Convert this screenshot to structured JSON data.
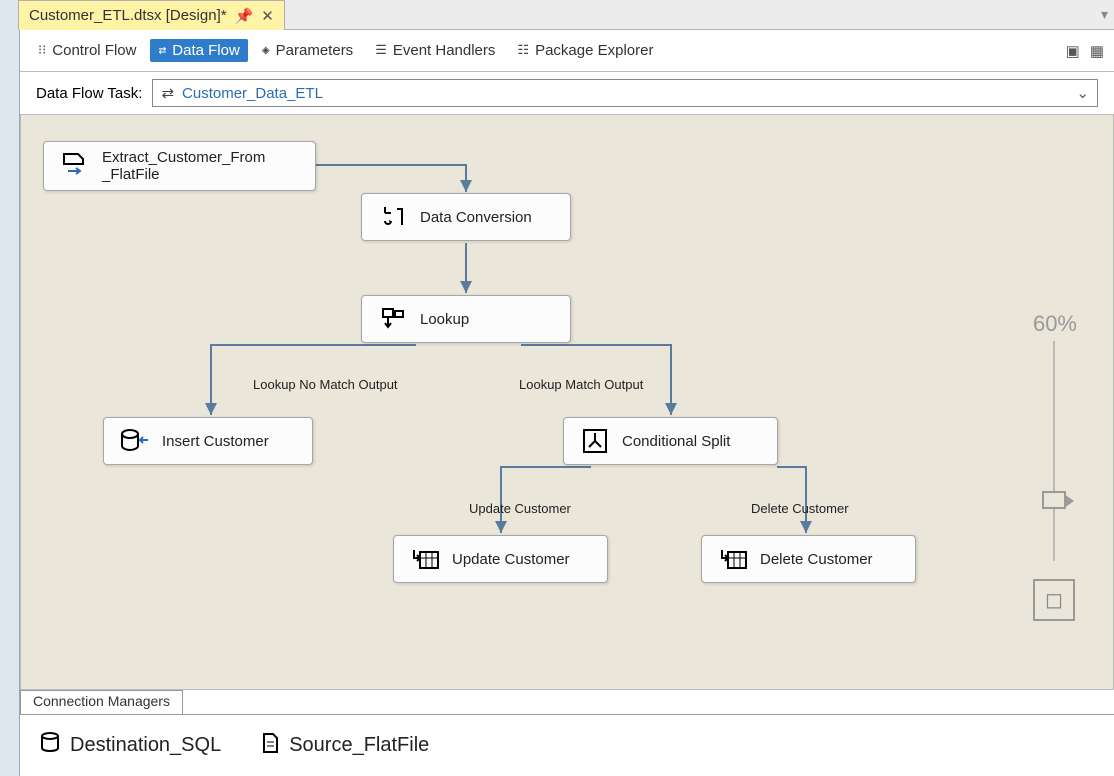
{
  "document_tab": {
    "title": "Customer_ETL.dtsx [Design]*"
  },
  "toolbar": {
    "tabs": [
      {
        "label": "Control Flow",
        "active": false
      },
      {
        "label": "Data Flow",
        "active": true
      },
      {
        "label": "Parameters",
        "active": false
      },
      {
        "label": "Event Handlers",
        "active": false
      },
      {
        "label": "Package Explorer",
        "active": false
      }
    ]
  },
  "data_flow_task": {
    "label": "Data Flow Task:",
    "selected": "Customer_Data_ETL"
  },
  "nodes": {
    "extract": {
      "line1": "Extract_Customer_From",
      "line2": "_FlatFile"
    },
    "dataconversion": "Data Conversion",
    "lookup": "Lookup",
    "insert": "Insert Customer",
    "condsplit": "Conditional Split",
    "update": "Update Customer",
    "delete": "Delete Customer"
  },
  "edges": {
    "no_match": "Lookup No Match Output",
    "match": "Lookup Match Output",
    "update": "Update Customer",
    "delete": "Delete Customer"
  },
  "zoom": {
    "percent_label": "60%"
  },
  "connection_managers": {
    "panel_title": "Connection Managers",
    "items": [
      {
        "name": "Destination_SQL",
        "icon": "database"
      },
      {
        "name": "Source_FlatFile",
        "icon": "flatfile"
      }
    ]
  }
}
